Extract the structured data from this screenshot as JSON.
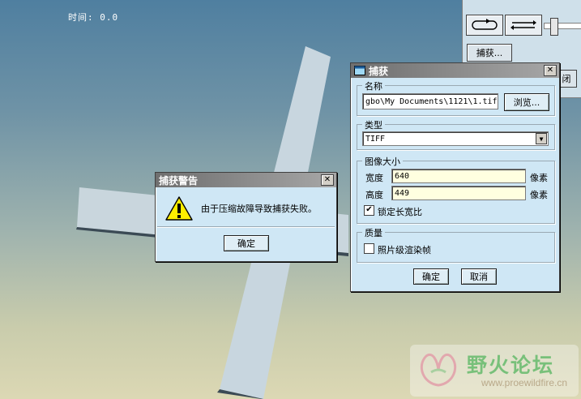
{
  "viewport": {
    "time_label": "时间: 0.0"
  },
  "toolbar": {
    "capture_button_label": "捕获...",
    "close_button_partial": "闭"
  },
  "capture_dialog": {
    "title": "捕获",
    "name_group": {
      "label": "名称",
      "path_value": "gbo\\My Documents\\1121\\1.tif",
      "browse_button": "浏览..."
    },
    "type_group": {
      "label": "类型",
      "selected": "TIFF"
    },
    "size_group": {
      "label": "图像大小",
      "width_label": "宽度",
      "width_value": "640",
      "width_unit": "像素",
      "height_label": "高度",
      "height_value": "449",
      "height_unit": "像素",
      "lock_aspect_label": "锁定长宽比",
      "lock_aspect_checked": true
    },
    "quality_group": {
      "label": "质量",
      "photo_render_label": "照片级渲染帧",
      "photo_render_checked": false
    },
    "ok_button": "确定",
    "cancel_button": "取消"
  },
  "warning_dialog": {
    "title": "捕获警告",
    "message": "由于压缩故障导致捕获失败。",
    "ok_button": "确定"
  },
  "watermark": {
    "title": "野火论坛",
    "url": "www.proewildfire.cn"
  },
  "colors": {
    "dialog_bg": "#cfe7f5",
    "title_bar": "#8a8a8a",
    "field_highlight": "#ffffe0"
  }
}
